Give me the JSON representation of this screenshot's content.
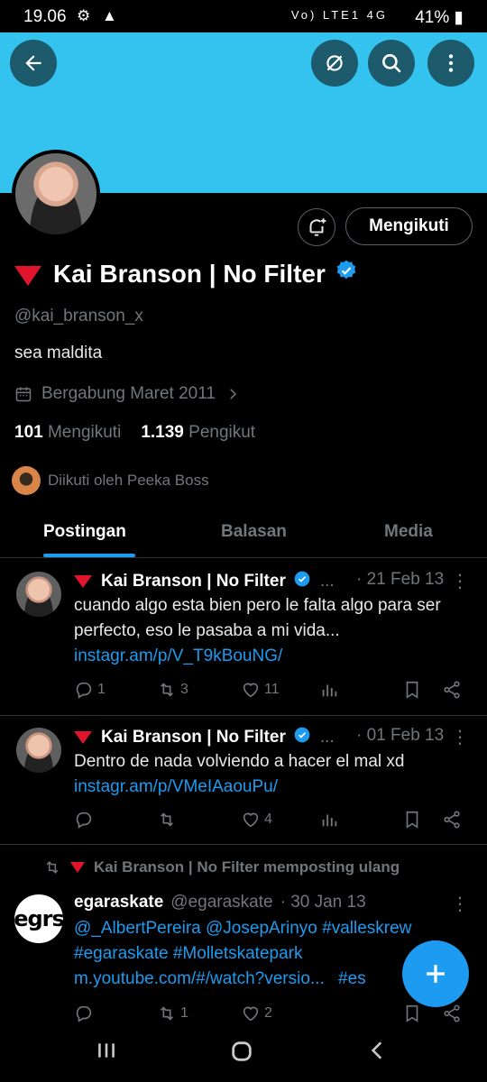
{
  "status_bar": {
    "time": "19.06",
    "left_icons": "⚙ ▲",
    "right_icons": "Vo) LTE1 4G",
    "battery": "41%"
  },
  "profile": {
    "name": "Kai Branson | No Filter",
    "handle": "@kai_branson_x",
    "bio": "sea maldita",
    "joined": "Bergabung Maret 2011",
    "following_count": "101",
    "following_label": "Mengikuti",
    "followers_count": "1.139",
    "followers_label": "Pengikut",
    "followed_by": "Diikuti oleh Peeka Boss",
    "follow_button": "Mengikuti"
  },
  "tabs": [
    {
      "label": "Postingan"
    },
    {
      "label": "Balasan"
    },
    {
      "label": "Media"
    }
  ],
  "posts": [
    {
      "name": "Kai Branson | No Filter",
      "ellipsis": "...",
      "date": "· 21 Feb 13",
      "text": "cuando algo  esta bien pero le falta algo para ser perfecto, eso le pasaba a mi vida...",
      "link": "instagr.am/p/V_T9kBouNG/",
      "replies": "1",
      "reposts": "3",
      "likes": "11"
    },
    {
      "name": "Kai Branson | No Filter",
      "ellipsis": "...",
      "date": "· 01 Feb 13",
      "text": "Dentro de nada volviendo a hacer el mal xd",
      "link": "instagr.am/p/VMeIAaouPu/",
      "replies": "",
      "reposts": "",
      "likes": "4"
    },
    {
      "repost_label": "Kai Branson | No Filter memposting ulang",
      "avatar_text": "egrs",
      "name": "egaraskate",
      "handle": "@egaraskate",
      "date": "· 30 Jan 13",
      "line1": "@_AlbertPereira @JosepArinyo #valleskrew",
      "line2": "#egaraskate #Molletskatepark",
      "line3a": "m.youtube.com/#/watch?versio...",
      "line3b": "#es",
      "replies": "",
      "reposts": "1",
      "likes": "2"
    }
  ],
  "colors": {
    "banner": "#33c3ee",
    "accent": "#1d9bf0",
    "background": "#000000",
    "muted": "#71767b"
  }
}
